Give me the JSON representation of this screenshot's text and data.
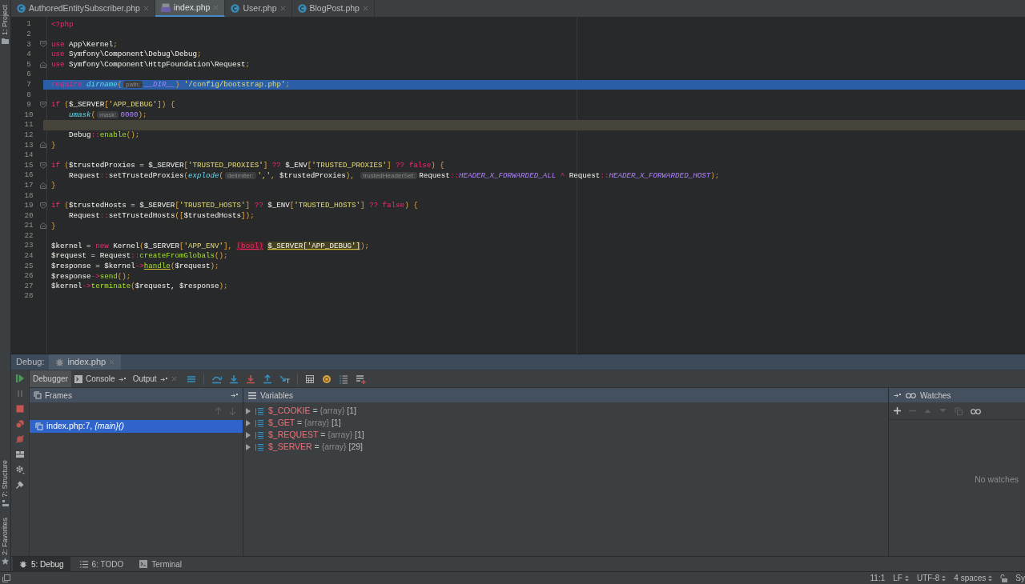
{
  "left_stripe": {
    "top": [
      {
        "label": "1: Project"
      }
    ],
    "bottom": [
      {
        "label": "7: Structure"
      },
      {
        "label": "2: Favorites"
      }
    ]
  },
  "editor_tabs": [
    {
      "label": "AuthoredEntitySubscriber.php",
      "kind": "class",
      "selected": false
    },
    {
      "label": "index.php",
      "kind": "php",
      "selected": true
    },
    {
      "label": "User.php",
      "kind": "class",
      "selected": false
    },
    {
      "label": "BlogPost.php",
      "kind": "class",
      "selected": false
    }
  ],
  "editor": {
    "lines": [
      {
        "number": "1",
        "fold_start": false,
        "fold_end": false,
        "highlighted": false,
        "caret_line": false,
        "tokens": [
          {
            "text": "<?php",
            "kind": "kw"
          }
        ]
      },
      {
        "number": "2",
        "fold_start": false,
        "fold_end": false,
        "highlighted": false,
        "caret_line": false
      },
      {
        "number": "3",
        "fold_start": true,
        "fold_end": false,
        "highlighted": false,
        "caret_line": false,
        "tokens": [
          {
            "text": "use",
            "kind": "kw"
          },
          {
            "text": " App\\Kernel",
            "kind": "plain"
          },
          {
            "text": ";",
            "kind": "punct"
          }
        ]
      },
      {
        "number": "4",
        "fold_start": false,
        "fold_end": false,
        "highlighted": false,
        "caret_line": false,
        "tokens": [
          {
            "text": "use",
            "kind": "kw"
          },
          {
            "text": " Symfony\\Component\\Debug\\Debug",
            "kind": "plain"
          },
          {
            "text": ";",
            "kind": "punct"
          }
        ]
      },
      {
        "number": "5",
        "fold_start": false,
        "fold_end": true,
        "highlighted": false,
        "caret_line": false,
        "tokens": [
          {
            "text": "use",
            "kind": "kw"
          },
          {
            "text": " Symfony\\Component\\HttpFoundation\\Request",
            "kind": "plain"
          },
          {
            "text": ";",
            "kind": "punct"
          }
        ]
      },
      {
        "number": "6",
        "fold_start": false,
        "fold_end": false,
        "highlighted": false,
        "caret_line": false
      },
      {
        "number": "7",
        "fold_start": false,
        "fold_end": false,
        "highlighted": true,
        "caret_line": false,
        "tokens": [
          {
            "text": "require ",
            "kind": "kw"
          },
          {
            "text": "dirname",
            "kind": "fn"
          },
          {
            "text": "(",
            "kind": "punct"
          },
          {
            "text": "path:",
            "kind": "hint"
          },
          {
            "text": "__DIR__",
            "kind": "const"
          },
          {
            "text": ")",
            "kind": "punct"
          },
          {
            "text": ".",
            "kind": "op"
          },
          {
            "text": "'/config/bootstrap.php'",
            "kind": "str"
          },
          {
            "text": ";",
            "kind": "punct"
          }
        ]
      },
      {
        "number": "8",
        "fold_start": false,
        "fold_end": false,
        "highlighted": false,
        "caret_line": false
      },
      {
        "number": "9",
        "fold_start": true,
        "fold_end": false,
        "highlighted": false,
        "caret_line": false,
        "tokens": [
          {
            "text": "if ",
            "kind": "kw"
          },
          {
            "text": "(",
            "kind": "punct"
          },
          {
            "text": "$_SERVER",
            "kind": "plain"
          },
          {
            "text": "[",
            "kind": "punct"
          },
          {
            "text": "'APP_DEBUG'",
            "kind": "str"
          },
          {
            "text": "]) {",
            "kind": "punct"
          }
        ]
      },
      {
        "number": "10",
        "fold_start": false,
        "fold_end": false,
        "highlighted": false,
        "caret_line": false,
        "tokens": [
          {
            "text": "    umask",
            "kind": "fn"
          },
          {
            "text": "(",
            "kind": "punct"
          },
          {
            "text": "mask:",
            "kind": "hint"
          },
          {
            "text": "0000",
            "kind": "num"
          },
          {
            "text": ");",
            "kind": "punct"
          }
        ]
      },
      {
        "number": "11",
        "fold_start": false,
        "fold_end": false,
        "highlighted": false,
        "caret_line": true
      },
      {
        "number": "12",
        "fold_start": false,
        "fold_end": false,
        "highlighted": false,
        "caret_line": false,
        "tokens": [
          {
            "text": "    Debug",
            "kind": "plain"
          },
          {
            "text": "::",
            "kind": "op"
          },
          {
            "text": "enable",
            "kind": "method"
          },
          {
            "text": "();",
            "kind": "punct"
          }
        ]
      },
      {
        "number": "13",
        "fold_start": false,
        "fold_end": true,
        "highlighted": false,
        "caret_line": false,
        "tokens": [
          {
            "text": "}",
            "kind": "punct"
          }
        ]
      },
      {
        "number": "14",
        "fold_start": false,
        "fold_end": false,
        "highlighted": false,
        "caret_line": false
      },
      {
        "number": "15",
        "fold_start": true,
        "fold_end": false,
        "highlighted": false,
        "caret_line": false,
        "tokens": [
          {
            "text": "if ",
            "kind": "kw"
          },
          {
            "text": "(",
            "kind": "punct"
          },
          {
            "text": "$trustedProxies = $_SERVER",
            "kind": "plain"
          },
          {
            "text": "[",
            "kind": "punct"
          },
          {
            "text": "'TRUSTED_PROXIES'",
            "kind": "str"
          },
          {
            "text": "] ",
            "kind": "punct"
          },
          {
            "text": "??",
            "kind": "op"
          },
          {
            "text": " $_ENV",
            "kind": "plain"
          },
          {
            "text": "[",
            "kind": "punct"
          },
          {
            "text": "'TRUSTED_PROXIES'",
            "kind": "str"
          },
          {
            "text": "] ",
            "kind": "punct"
          },
          {
            "text": "?? false",
            "kind": "kw"
          },
          {
            "text": ") {",
            "kind": "punct"
          }
        ]
      },
      {
        "number": "16",
        "fold_start": false,
        "fold_end": false,
        "highlighted": false,
        "caret_line": false,
        "tokens": [
          {
            "text": "    Request",
            "kind": "plain"
          },
          {
            "text": "::",
            "kind": "op"
          },
          {
            "text": "setTrustedProxies",
            "kind": "plain"
          },
          {
            "text": "(",
            "kind": "punct"
          },
          {
            "text": "explode",
            "kind": "fn"
          },
          {
            "text": "(",
            "kind": "punct"
          },
          {
            "text": "delimiter:",
            "kind": "hint"
          },
          {
            "text": "','",
            "kind": "str"
          },
          {
            "text": ", ",
            "kind": "punct"
          },
          {
            "text": "$trustedProxies",
            "kind": "plain"
          },
          {
            "text": "), ",
            "kind": "punct"
          },
          {
            "text": "trustedHeaderSet:",
            "kind": "hint"
          },
          {
            "text": "Request",
            "kind": "plain"
          },
          {
            "text": "::",
            "kind": "op"
          },
          {
            "text": "HEADER_X_FORWARDED_ALL",
            "kind": "const"
          },
          {
            "text": " ^ ",
            "kind": "op"
          },
          {
            "text": "Request",
            "kind": "plain"
          },
          {
            "text": "::",
            "kind": "op"
          },
          {
            "text": "HEADER_X_FORWARDED_HOST",
            "kind": "const"
          },
          {
            "text": ");",
            "kind": "punct"
          }
        ]
      },
      {
        "number": "17",
        "fold_start": false,
        "fold_end": true,
        "highlighted": false,
        "caret_line": false,
        "tokens": [
          {
            "text": "}",
            "kind": "punct"
          }
        ]
      },
      {
        "number": "18",
        "fold_start": false,
        "fold_end": false,
        "highlighted": false,
        "caret_line": false
      },
      {
        "number": "19",
        "fold_start": true,
        "fold_end": false,
        "highlighted": false,
        "caret_line": false,
        "tokens": [
          {
            "text": "if ",
            "kind": "kw"
          },
          {
            "text": "(",
            "kind": "punct"
          },
          {
            "text": "$trustedHosts = $_SERVER",
            "kind": "plain"
          },
          {
            "text": "[",
            "kind": "punct"
          },
          {
            "text": "'TRUSTED_HOSTS'",
            "kind": "str"
          },
          {
            "text": "] ",
            "kind": "punct"
          },
          {
            "text": "??",
            "kind": "op"
          },
          {
            "text": " $_ENV",
            "kind": "plain"
          },
          {
            "text": "[",
            "kind": "punct"
          },
          {
            "text": "'TRUSTED_HOSTS'",
            "kind": "str"
          },
          {
            "text": "] ",
            "kind": "punct"
          },
          {
            "text": "?? false",
            "kind": "kw"
          },
          {
            "text": ") {",
            "kind": "punct"
          }
        ]
      },
      {
        "number": "20",
        "fold_start": false,
        "fold_end": false,
        "highlighted": false,
        "caret_line": false,
        "tokens": [
          {
            "text": "    Request",
            "kind": "plain"
          },
          {
            "text": "::",
            "kind": "op"
          },
          {
            "text": "setTrustedHosts",
            "kind": "plain"
          },
          {
            "text": "([",
            "kind": "punct"
          },
          {
            "text": "$trustedHosts",
            "kind": "plain"
          },
          {
            "text": "]);",
            "kind": "punct"
          }
        ]
      },
      {
        "number": "21",
        "fold_start": false,
        "fold_end": true,
        "highlighted": false,
        "caret_line": false,
        "tokens": [
          {
            "text": "}",
            "kind": "punct"
          }
        ]
      },
      {
        "number": "22",
        "fold_start": false,
        "fold_end": false,
        "highlighted": false,
        "caret_line": false
      },
      {
        "number": "23",
        "fold_start": false,
        "fold_end": false,
        "highlighted": false,
        "caret_line": false,
        "tokens": [
          {
            "text": "$kernel = ",
            "kind": "plain"
          },
          {
            "text": "new",
            "kind": "kw"
          },
          {
            "text": " Kernel",
            "kind": "plain"
          },
          {
            "text": "(",
            "kind": "punct"
          },
          {
            "text": "$_SERVER",
            "kind": "plain"
          },
          {
            "text": "[",
            "kind": "punct"
          },
          {
            "text": "'APP_ENV'",
            "kind": "str"
          },
          {
            "text": "], ",
            "kind": "punct"
          },
          {
            "text": "(bool)",
            "kind": "cast"
          },
          {
            "text": "$_SERVER['APP_DEBUG']",
            "kind": "warn"
          },
          {
            "text": ");",
            "kind": "punct"
          }
        ]
      },
      {
        "number": "24",
        "fold_start": false,
        "fold_end": false,
        "highlighted": false,
        "caret_line": false,
        "tokens": [
          {
            "text": "$request = Request",
            "kind": "plain"
          },
          {
            "text": "::",
            "kind": "op"
          },
          {
            "text": "createFromGlobals",
            "kind": "method"
          },
          {
            "text": "();",
            "kind": "punct"
          }
        ]
      },
      {
        "number": "25",
        "fold_start": false,
        "fold_end": false,
        "highlighted": false,
        "caret_line": false,
        "tokens": [
          {
            "text": "$response = $kernel",
            "kind": "plain"
          },
          {
            "text": "->",
            "kind": "op"
          },
          {
            "text": "handle",
            "kind": "method_warn"
          },
          {
            "text": "(",
            "kind": "punct"
          },
          {
            "text": "$request",
            "kind": "plain"
          },
          {
            "text": ");",
            "kind": "punct"
          }
        ]
      },
      {
        "number": "26",
        "fold_start": false,
        "fold_end": false,
        "highlighted": false,
        "caret_line": false,
        "tokens": [
          {
            "text": "$response",
            "kind": "plain"
          },
          {
            "text": "->",
            "kind": "op"
          },
          {
            "text": "send",
            "kind": "method"
          },
          {
            "text": "();",
            "kind": "punct"
          }
        ]
      },
      {
        "number": "27",
        "fold_start": false,
        "fold_end": false,
        "highlighted": false,
        "caret_line": false,
        "tokens": [
          {
            "text": "$kernel",
            "kind": "plain"
          },
          {
            "text": "->",
            "kind": "op"
          },
          {
            "text": "terminate",
            "kind": "method"
          },
          {
            "text": "(",
            "kind": "punct"
          },
          {
            "text": "$request, $response",
            "kind": "plain"
          },
          {
            "text": ");",
            "kind": "punct"
          }
        ]
      },
      {
        "number": "28",
        "fold_start": false,
        "fold_end": false,
        "highlighted": false,
        "caret_line": false
      }
    ]
  },
  "debug": {
    "title": "Debug:",
    "session_tab": "index.php",
    "subtabs": [
      {
        "label": "Debugger",
        "kind": "plain",
        "selected": true
      },
      {
        "label": "Console",
        "kind": "console",
        "selected": false
      },
      {
        "label": "Output",
        "kind": "output",
        "selected": false
      }
    ],
    "frames": {
      "title": "Frames",
      "items": [
        {
          "label": "index.php:7, *{main}()*",
          "selected": true
        }
      ]
    },
    "variables": {
      "title": "Variables",
      "items": [
        {
          "name": "$_COOKIE",
          "operator": "=",
          "type": "{array}",
          "count": "[1]"
        },
        {
          "name": "$_GET",
          "operator": "=",
          "type": "{array}",
          "count": "[1]"
        },
        {
          "name": "$_REQUEST",
          "operator": "=",
          "type": "{array}",
          "count": "[1]"
        },
        {
          "name": "$_SERVER",
          "operator": "=",
          "type": "{array}",
          "count": "[29]"
        }
      ]
    },
    "watches": {
      "title": "Watches",
      "empty_text": "No watches"
    }
  },
  "tool_windows": [
    {
      "label": "5: Debug",
      "kind": "debug",
      "selected": true
    },
    {
      "label": "6: TODO",
      "kind": "todo",
      "selected": false
    },
    {
      "label": "Terminal",
      "kind": "terminal",
      "selected": false
    }
  ],
  "status_bar": [
    {
      "text": "11:1",
      "dropdown": false
    },
    {
      "text": "LF",
      "dropdown": true
    },
    {
      "text": "UTF-8",
      "dropdown": true
    },
    {
      "text": "4 spaces",
      "dropdown": true
    },
    {
      "text": "Sy",
      "dropdown": false
    }
  ]
}
